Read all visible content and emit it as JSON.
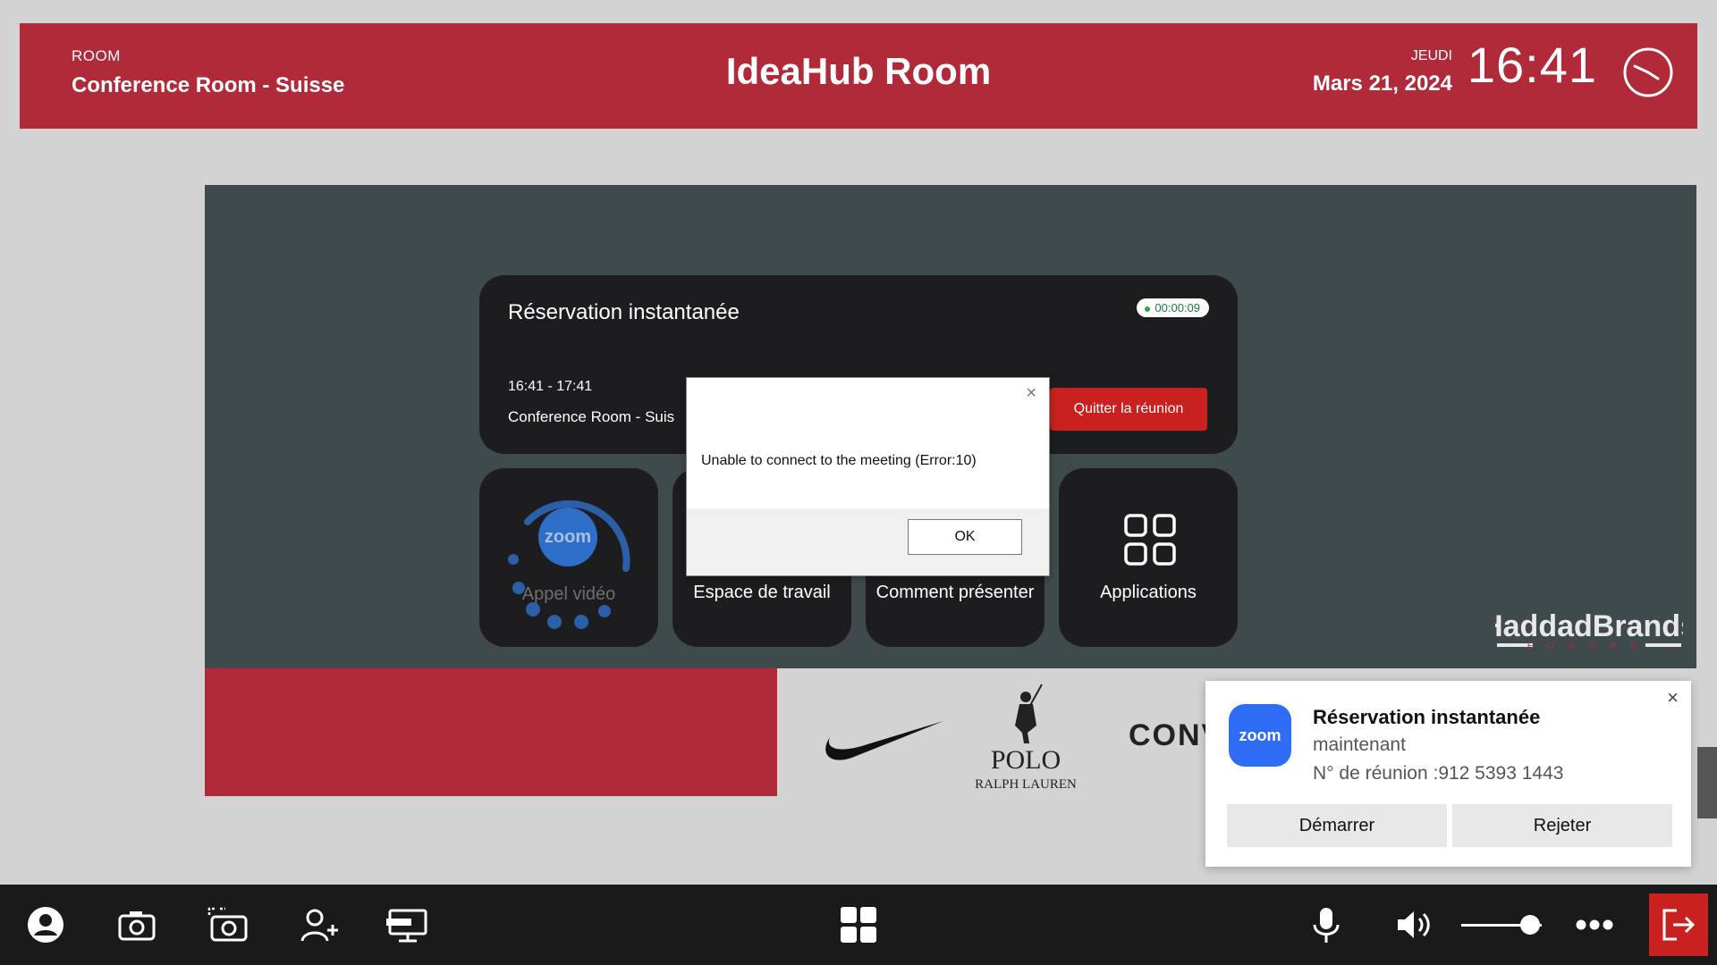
{
  "header": {
    "room_label": "ROOM",
    "room_name": "Conference Room - Suisse",
    "title": "IdeaHub Room",
    "day": "JEUDI",
    "date": "Mars 21, 2024",
    "time": "16:41",
    "color": "#b02a3a"
  },
  "meeting": {
    "title": "Réservation instantanée",
    "timer": "00:00:09",
    "time_range": "16:41 - 17:41",
    "room": "Conference Room - Suis",
    "leave_label": "Quitter la réunion"
  },
  "tiles": {
    "video_call": "Appel vidéo",
    "zoom_badge": "zoom",
    "workspace": "Espace de travail",
    "how_to_present": "Comment présenter",
    "applications": "Applications"
  },
  "dialog": {
    "close": "×",
    "message": "Unable to connect to the meeting (Error:10)",
    "ok_label": "OK"
  },
  "notification": {
    "app_badge": "zoom",
    "title": "Réservation instantanée",
    "when": "maintenant",
    "meeting_number": "N° de réunion :912 5393 1443",
    "close": "×",
    "start_label": "Démarrer",
    "reject_label": "Rejeter"
  },
  "wall": {
    "brand": "HaddadBrands",
    "brand_sub": "EUROPE",
    "polo_line1": "POLO",
    "polo_line2": "RALPH LAUREN",
    "converse": "CONV"
  },
  "taskbar": {
    "icons": [
      "user-icon",
      "camera-icon",
      "screenshot-camera-icon",
      "add-user-icon",
      "hdmi-icon",
      "apps-grid-icon",
      "microphone-icon",
      "volume-icon",
      "more-icon",
      "exit-icon"
    ],
    "volume_level": 0.85,
    "accent": "#c8211f"
  }
}
